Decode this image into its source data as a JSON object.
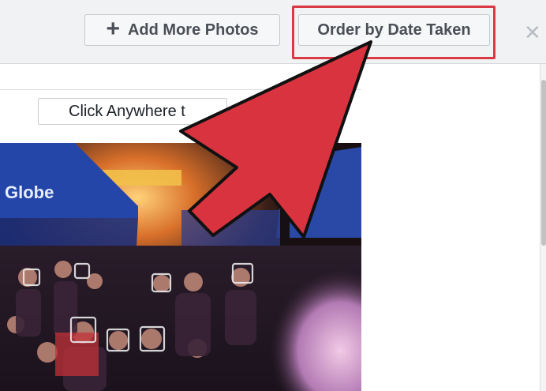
{
  "toolbar": {
    "add_more_label": "Add More Photos",
    "order_label": "Order by Date Taken",
    "close_glyph": "✕"
  },
  "photo_area": {
    "hint_text": "Click Anywhere t",
    "banner_text": "Globe",
    "face_tags_count": 7
  },
  "icons": [
    "plus-icon",
    "close-icon",
    "arrow-pointer-icon"
  ],
  "colors": {
    "highlight": "#d93a46",
    "arrow": "#d9333f",
    "button_bg": "#f6f7f9",
    "button_text": "#4b4f56"
  }
}
